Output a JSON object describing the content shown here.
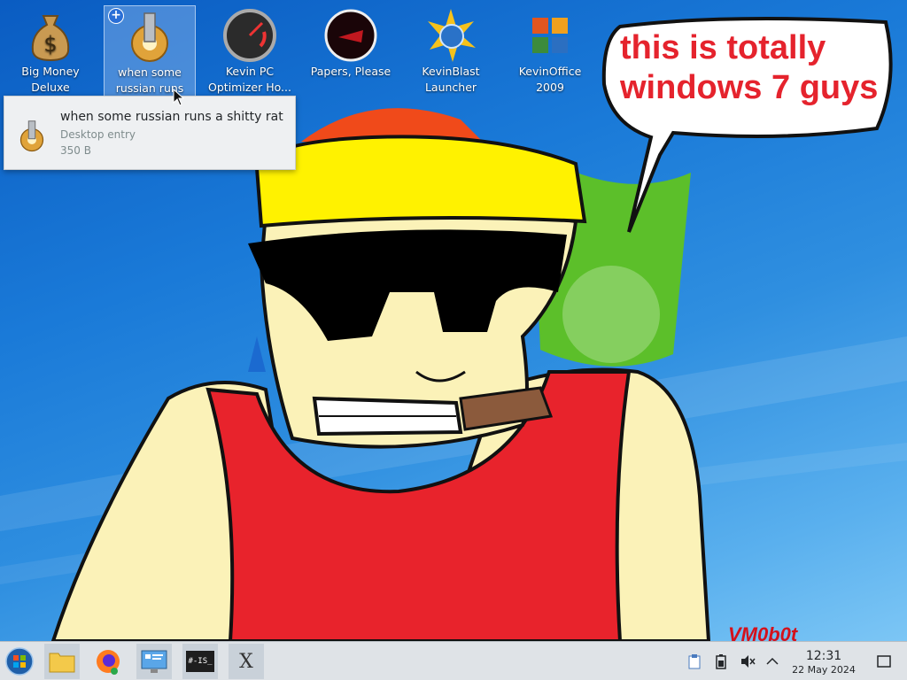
{
  "desktop": {
    "icons": [
      {
        "label": "Big Money Deluxe",
        "icon": "money-bag-icon"
      },
      {
        "label": "when some russian runs a...",
        "icon": "gear-icon"
      },
      {
        "label": "Kevin PC Optimizer Ho...",
        "icon": "gauge-icon"
      },
      {
        "label": "Papers, Please",
        "icon": "papers-please-icon"
      },
      {
        "label": "KevinBlast Launcher",
        "icon": "starburst-globe-icon"
      },
      {
        "label": "KevinOffice 2009",
        "icon": "office-logo-icon"
      }
    ],
    "selected_badge": "+"
  },
  "tooltip": {
    "title": "when some russian runs a shitty rat",
    "type": "Desktop entry",
    "size": "350 B",
    "icon": "gear-icon"
  },
  "wallpaper": {
    "speech_bubble": "this is totally windows 7 guys",
    "signature": "VM0b0t",
    "colors": {
      "text": "#e5232d",
      "shirt": "#e8232c",
      "skin": "#fbf2b8",
      "hat": "#fff200"
    }
  },
  "taskbar": {
    "launchers": [
      {
        "name": "start-menu",
        "icon": "windows-orb-icon"
      },
      {
        "name": "file-manager",
        "icon": "folder-icon"
      },
      {
        "name": "firefox",
        "icon": "firefox-icon"
      },
      {
        "name": "system-settings",
        "icon": "monitor-settings-icon"
      },
      {
        "name": "terminal",
        "icon": "terminal-icon",
        "glyph": "#-IS_"
      },
      {
        "name": "x-app",
        "icon": "x-icon",
        "glyph": "X"
      }
    ],
    "tray": [
      "clipboard-icon",
      "battery-icon",
      "volume-muted-icon",
      "chevron-up-icon"
    ],
    "clock": {
      "time": "12:31",
      "date": "22 May 2024"
    },
    "show_desktop": "show-desktop-icon"
  }
}
